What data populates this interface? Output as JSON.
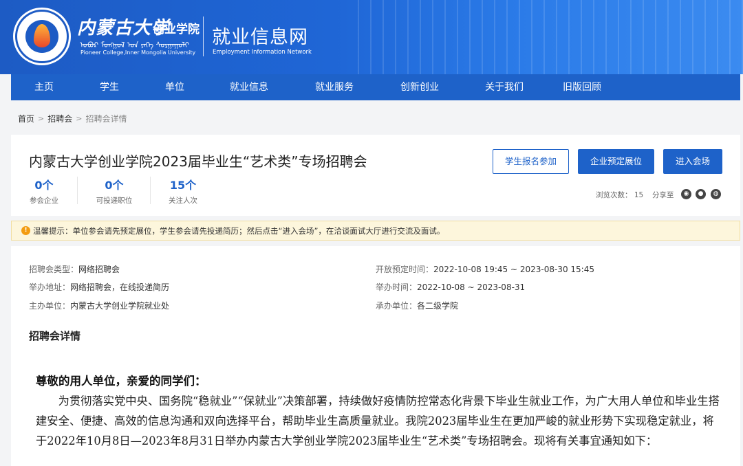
{
  "header": {
    "university_name": "内蒙古大学",
    "college_name": "创业学院",
    "mongolian_text": "ᠣᠪᠤᠷ ᠮᠣᠩᠭᠣᠯ ᠤᠨ ᠶᠡᠬᠡ ᠰᠤᠷᠭᠠᠭᠤᠯᠢ",
    "english_name": "Pioneer College,Inner Mongolia University",
    "site_title": "就业信息网",
    "site_subtitle": "Employment Information Network",
    "brand_color": "#1e62c9"
  },
  "nav": {
    "items": [
      {
        "label": "主页"
      },
      {
        "label": "学生"
      },
      {
        "label": "单位"
      },
      {
        "label": "就业信息"
      },
      {
        "label": "就业服务"
      },
      {
        "label": "创新创业"
      },
      {
        "label": "关于我们"
      },
      {
        "label": "旧版回顾"
      }
    ]
  },
  "breadcrumb": {
    "home": "首页",
    "level1": "招聘会",
    "current": "招聘会详情",
    "separator": ">"
  },
  "fair": {
    "title": "内蒙古大学创业学院2023届毕业生“艺术类”专场招聘会",
    "stats": [
      {
        "value": "0个",
        "label": "参会企业"
      },
      {
        "value": "0个",
        "label": "可投递职位"
      },
      {
        "value": "15个",
        "label": "关注人次"
      }
    ],
    "buttons": {
      "student_signup": "学生报名参加",
      "company_booth": "企业预定展位",
      "enter_venue": "进入会场"
    },
    "views_label": "浏览次数：",
    "views_count": "15",
    "share_label": "分享至",
    "share_icons": [
      "wechat-icon",
      "qq-icon",
      "weibo-icon"
    ]
  },
  "notice": {
    "icon": "warning-icon",
    "text": "温馨提示：单位参会请先预定展位，学生参会请先投递简历；然后点击“进入会场”，在洽谈面试大厅进行交流及面试。"
  },
  "details": {
    "type_label": "招聘会类型：",
    "type_value": "网络招聘会",
    "address_label": "举办地址：",
    "address_value": "网络招聘会，在线投递简历",
    "organizer_label": "主办单位：",
    "organizer_value": "内蒙古大学创业学院就业处",
    "booking_label": "开放预定时间：",
    "booking_value": "2022-10-08 19:45 ~ 2023-08-30 15:45",
    "time_label": "举办时间：",
    "time_value": "2022-10-08 ~ 2023-08-31",
    "undertaker_label": "承办单位：",
    "undertaker_value": "各二级学院",
    "section_title": "招聘会详情",
    "greeting": "尊敬的用人单位，亲爱的同学们：",
    "paragraph": "为贯彻落实党中央、国务院“稳就业”“保就业”决策部署，持续做好疫情防控常态化背景下毕业生就业工作，为广大用人单位和毕业生搭建安全、便捷、高效的信息沟通和双向选择平台，帮助毕业生高质量就业。我院2023届毕业生在更加严峻的就业形势下实现稳定就业，将于2022年10月8日—2023年8月31日举办内蒙古大学创业学院2023届毕业生“艺术类”专场招聘会。现将有关事宜通知如下："
  }
}
